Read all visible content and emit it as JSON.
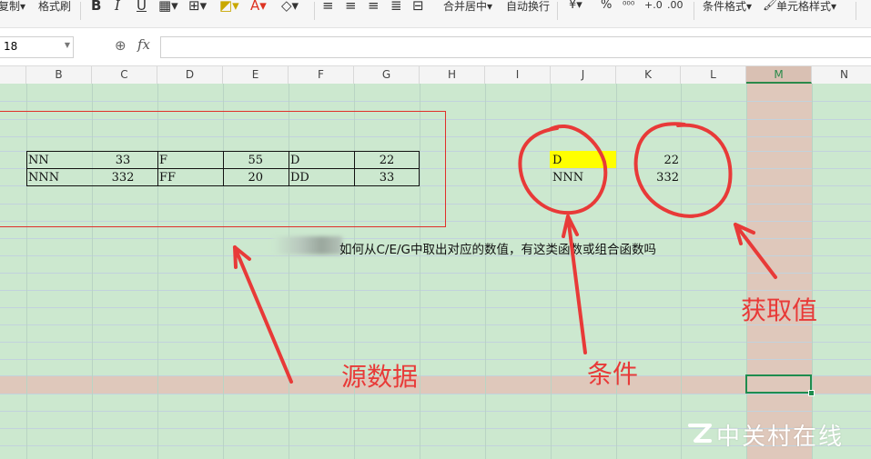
{
  "ribbon": {
    "copy_label": "复制▾",
    "format_painter_label": "格式刷",
    "bold_icon": "B",
    "italic_icon": "I",
    "underline_icon": "U",
    "merge_label": "合并居中▾",
    "wrap_label": "自动换行",
    "currency_icon": "¥▾",
    "percent_icon": "%",
    "cond_format_label": "条件格式▾",
    "cell_style_label": "单元格样式▾"
  },
  "formula_bar": {
    "name_box_value": "18",
    "fx_label": "fx",
    "formula_value": ""
  },
  "columns": [
    "B",
    "C",
    "D",
    "E",
    "F",
    "G",
    "H",
    "I",
    "J",
    "K",
    "L",
    "M",
    "N"
  ],
  "selected_column": "M",
  "table": {
    "rows": [
      [
        "NN",
        "33",
        "F",
        "55",
        "D",
        "22"
      ],
      [
        "NNN",
        "332",
        "FF",
        "20",
        "DD",
        "33"
      ]
    ]
  },
  "lookup": {
    "conditions": [
      "D",
      "NNN"
    ],
    "results": [
      "22",
      "332"
    ]
  },
  "question_text": "如何从C/E/G中取出对应的数值，有这类函数或组合函数吗",
  "annotations": {
    "source_label": "源数据",
    "condition_label": "条件",
    "result_label": "获取值",
    "color": "#e83a38"
  },
  "watermark": "中关村在线",
  "colors": {
    "grid_bg": "#cce8cf",
    "selection_band": "#dfc8bb",
    "active_border": "#1e8c4e",
    "highlight": "#ffff00"
  }
}
